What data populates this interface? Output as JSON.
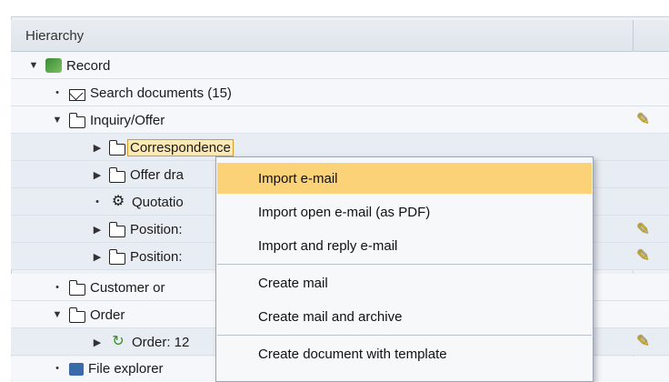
{
  "header": {
    "column_hierarchy": "Hierarchy"
  },
  "tree": [
    {
      "label": "Record",
      "icon": "record-icon",
      "twisty": "▼"
    },
    {
      "label": "Search documents (15)",
      "icon": "envelope-icon",
      "twisty": "•"
    },
    {
      "label": "Inquiry/Offer",
      "icon": "open-folder-icon",
      "twisty": "▼"
    },
    {
      "label": "Correspondence",
      "icon": "folder-icon",
      "twisty": "▶",
      "selected": true
    },
    {
      "label": "Offer dra",
      "icon": "folder-icon",
      "twisty": "▶"
    },
    {
      "label": "Quotatio",
      "icon": "quotation-icon",
      "twisty": "•"
    },
    {
      "label": "Position:",
      "icon": "folder-icon",
      "twisty": "▶"
    },
    {
      "label": "Position:",
      "icon": "folder-icon",
      "twisty": "▶"
    },
    {
      "label": "Customer or",
      "icon": "folder-icon",
      "twisty": "•"
    },
    {
      "label": "Order",
      "icon": "open-folder-icon",
      "twisty": "▼"
    },
    {
      "label": "Order: 12",
      "icon": "order-icon",
      "twisty": "▶"
    },
    {
      "label": "File explorer",
      "icon": "file-explorer-icon",
      "twisty": "•"
    }
  ],
  "context_menu": {
    "items": [
      {
        "label": "Import e-mail",
        "highlighted": true
      },
      {
        "label": "Import open e-mail (as PDF)"
      },
      {
        "label": "Import and reply e-mail"
      },
      {
        "label": "Create mail"
      },
      {
        "label": "Create mail and archive"
      },
      {
        "label": "Create document with template"
      }
    ]
  },
  "colors": {
    "menu_highlight": "#fbd277",
    "selection_border": "#d89a2a",
    "header_bg": "#e3e8ee"
  }
}
